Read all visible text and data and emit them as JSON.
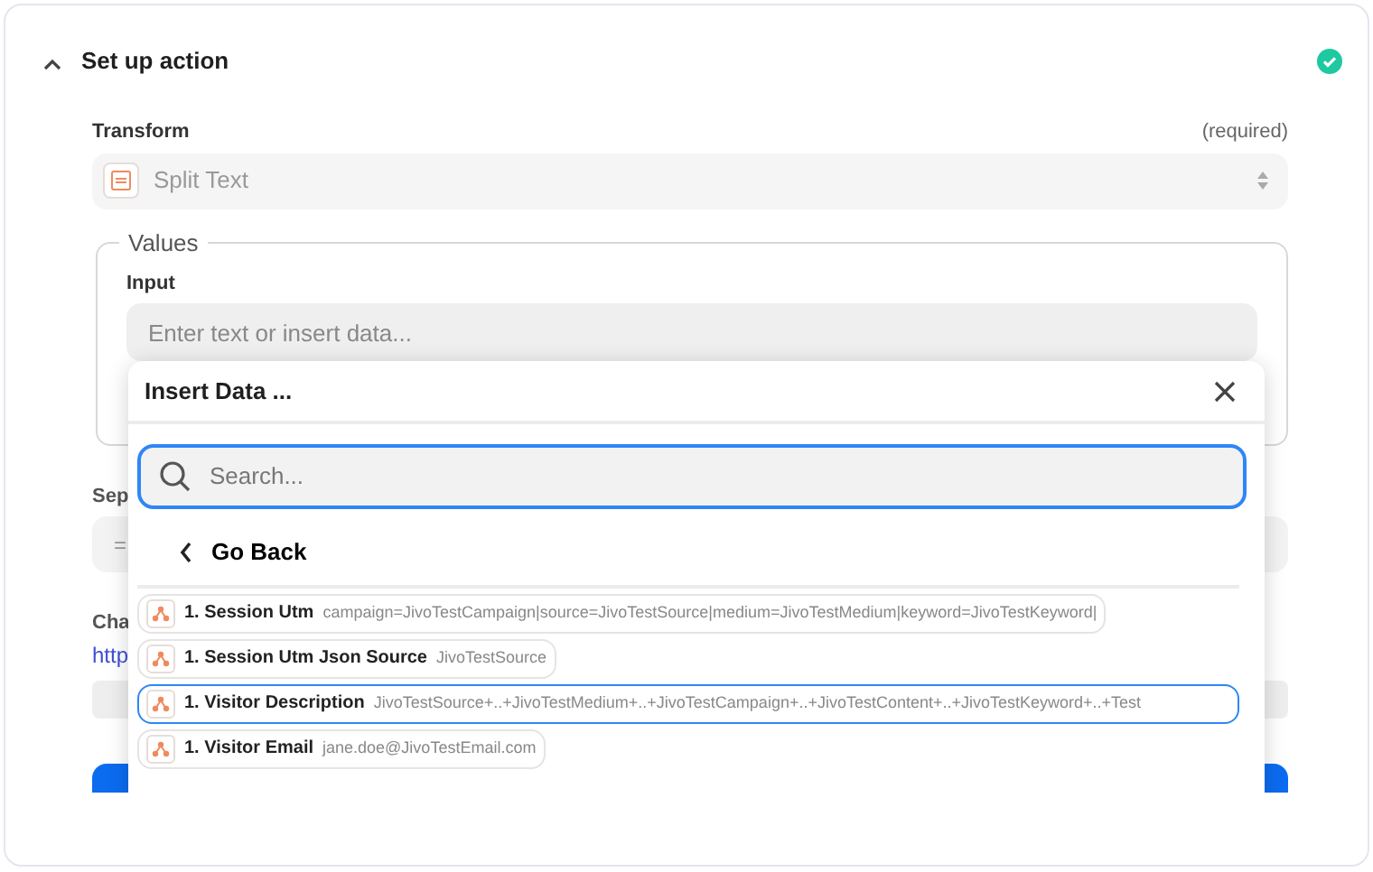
{
  "step": {
    "title": "Set up action",
    "expanded": true,
    "complete": true
  },
  "transform": {
    "label": "Transform",
    "required_note": "(required)",
    "value": "Split Text"
  },
  "values": {
    "legend": "Values",
    "input_label": "Input",
    "input_placeholder": "Enter text or insert data..."
  },
  "background_fields": [
    {
      "kind": "label",
      "text": "Sep"
    },
    {
      "kind": "field",
      "text": "="
    },
    {
      "kind": "label",
      "text": "Cha"
    },
    {
      "kind": "link",
      "text": "http"
    },
    {
      "kind": "bar"
    },
    {
      "kind": "button"
    }
  ],
  "insert_data": {
    "title": "Insert Data ...",
    "search_placeholder": "Search...",
    "back_label": "Go Back",
    "items": [
      {
        "name": "1. Session Utm",
        "value": "campaign=JivoTestCampaign|source=JivoTestSource|medium=JivoTestMedium|keyword=JivoTestKeyword|",
        "selected": false
      },
      {
        "name": "1. Session Utm Json Source",
        "value": "JivoTestSource",
        "selected": false
      },
      {
        "name": "1. Visitor Description",
        "value": "JivoTestSource+..+JivoTestMedium+..+JivoTestCampaign+..+JivoTestContent+..+JivoTestKeyword+..+Test",
        "selected": true
      },
      {
        "name": "1. Visitor Email",
        "value": "jane.doe@JivoTestEmail.com",
        "selected": false
      }
    ]
  }
}
